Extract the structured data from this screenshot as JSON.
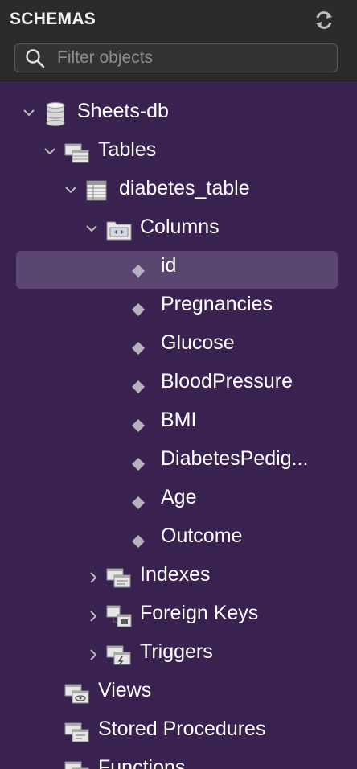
{
  "header": {
    "title": "SCHEMAS",
    "search_placeholder": "Filter objects"
  },
  "tree": {
    "schema": "Sheets-db",
    "tables": "Tables",
    "table": "diabetes_table",
    "columns_folder": "Columns",
    "columns": [
      "id",
      "Pregnancies",
      "Glucose",
      "BloodPressure",
      "BMI",
      "DiabetesPedig...",
      "Age",
      "Outcome"
    ],
    "indexes": "Indexes",
    "foreign_keys": "Foreign Keys",
    "triggers": "Triggers",
    "views": "Views",
    "stored_procedures": "Stored Procedures",
    "functions": "Functions"
  }
}
